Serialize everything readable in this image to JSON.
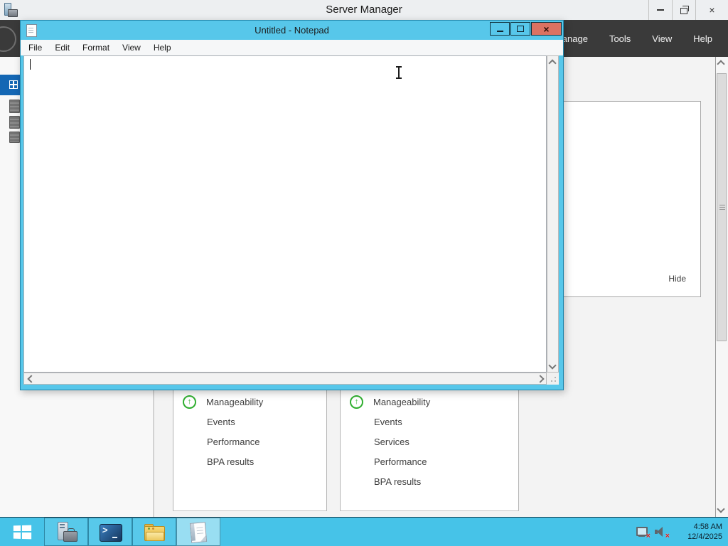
{
  "icons": {
    "close_glyph": "×",
    "ok_arrow": "↑",
    "powershell_prompt": ">"
  },
  "server_manager": {
    "title": "Server Manager",
    "menu": [
      "Manage",
      "Tools",
      "View",
      "Help"
    ],
    "welcome_tile": {
      "hide_label": "Hide"
    },
    "dashboard_tiles": [
      {
        "header": "Manageability",
        "items": [
          "Events",
          "Performance",
          "BPA results"
        ]
      },
      {
        "header": "Manageability",
        "items": [
          "Events",
          "Services",
          "Performance",
          "BPA results"
        ]
      }
    ]
  },
  "notepad": {
    "title": "Untitled - Notepad",
    "menu": [
      "File",
      "Edit",
      "Format",
      "View",
      "Help"
    ],
    "text_content": ""
  },
  "taskbar": {
    "clock": {
      "time": "4:58 AM",
      "date": "12/4/2025"
    }
  },
  "colors": {
    "notepad_chrome": "#57c7ea",
    "taskbar": "#46c3e8",
    "close_button": "#dc7262",
    "sidebar_selected": "#1467b4",
    "status_ok_green": "#2fae2f",
    "dark_band": "#3a3a3a"
  }
}
